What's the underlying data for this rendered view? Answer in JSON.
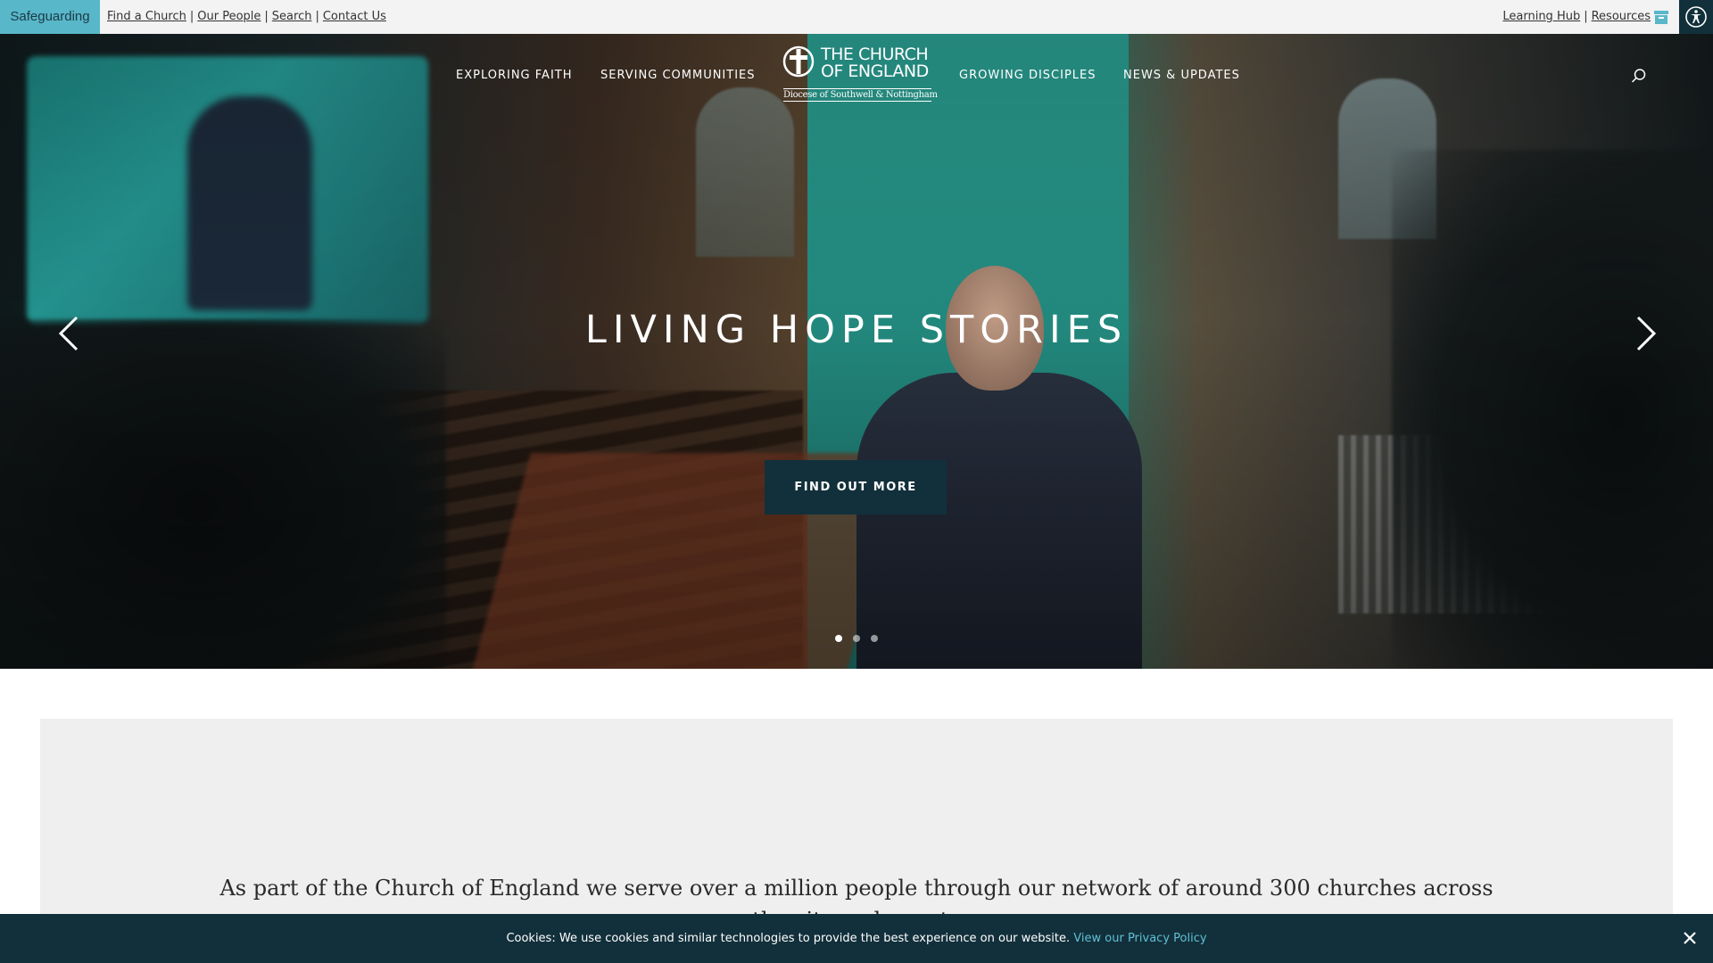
{
  "topbar": {
    "safeguarding": "Safeguarding",
    "quick_links": [
      "Find a Church",
      "Our People",
      "Search",
      "Contact Us"
    ],
    "separator": "|",
    "right_links": [
      "Learning Hub",
      "Resources"
    ],
    "icons": [
      "archive-icon",
      "accessibility-icon"
    ],
    "colors": {
      "safeguarding_bg": "#58b7c9",
      "accessibility_bg": "#12303b"
    }
  },
  "nav": {
    "items": [
      "EXPLORING FAITH",
      "SERVING COMMUNITIES",
      "GROWING DISCIPLES",
      "NEWS & UPDATES"
    ],
    "logo": {
      "title_line1": "THE CHURCH",
      "title_line2": "OF ENGLAND",
      "subtitle": "Diocese of Southwell & Nottingham"
    },
    "search_icon": "search-icon"
  },
  "hero": {
    "title": "LIVING HOPE STORIES",
    "cta_label": "FIND OUT MORE",
    "slides_total": 3,
    "active_slide": 1,
    "prev_icon": "chevron-left-icon",
    "next_icon": "chevron-right-icon",
    "colors": {
      "cta_bg": "#12303b"
    }
  },
  "intro": {
    "text": "As part of the Church of England we serve over a million people through our network of around 300 churches across the city and county"
  },
  "cookie": {
    "text": "Cookies: We use cookies and similar technologies to provide the best experience on our website.",
    "link": "View our Privacy Policy",
    "close_icon": "close-icon",
    "colors": {
      "bg": "#12303b",
      "link": "#5fc0d6"
    }
  }
}
